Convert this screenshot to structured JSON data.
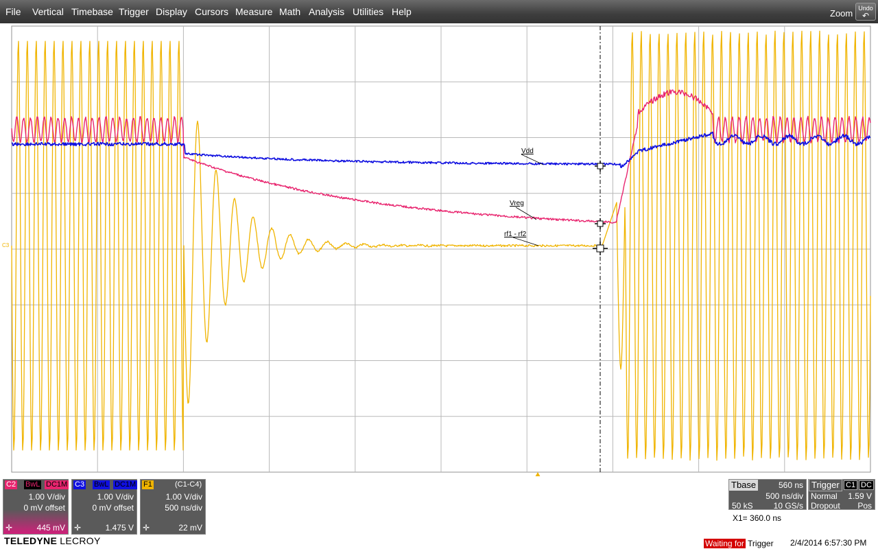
{
  "menu": {
    "items": [
      "File",
      "Vertical",
      "Timebase",
      "Trigger",
      "Display",
      "Cursors",
      "Measure",
      "Math",
      "Analysis",
      "Utilities",
      "Help"
    ],
    "zoom_label": "Zoom",
    "undo_label": "Undo"
  },
  "colors": {
    "c2": "#e8246e",
    "c3": "#1010e0",
    "f1": "#f0b400",
    "grid": "#b8b8b8",
    "cursor": "#000000"
  },
  "chart_data": {
    "type": "line",
    "x_divisions": 10,
    "y_divisions": 8,
    "series": [
      {
        "name": "Vdd",
        "label": "Vdd"
      },
      {
        "name": "Vreg",
        "label": "Vreg"
      },
      {
        "name": "rf1 - rf2",
        "label": "rf1 - rf2"
      }
    ],
    "left_marker": "C3"
  },
  "channels": [
    {
      "id": "C2",
      "badges": [
        "BwL",
        "DC1M"
      ],
      "scale": "1.00 V/div",
      "offset": "0 mV offset",
      "value": "445 mV",
      "cross": "✛"
    },
    {
      "id": "C3",
      "badges": [
        "BwL",
        "DC1M"
      ],
      "scale": "1.00 V/div",
      "offset": "0 mV offset",
      "value": "1.475 V",
      "cross": "✛"
    },
    {
      "id": "F1",
      "badges": [
        "(C1-C4)"
      ],
      "scale": "1.00 V/div",
      "offset": "500 ns/div",
      "value": "22 mV",
      "cross": "✛"
    }
  ],
  "timebase": {
    "title": "Tbase",
    "delay": "560 ns",
    "tdiv": "500 ns/div",
    "samples": "50 kS",
    "rate": "10 GS/s"
  },
  "trigger": {
    "title": "Trigger",
    "badges": [
      "C1",
      "DC"
    ],
    "mode": "Normal",
    "level": "1.59 V",
    "type": "Dropout",
    "slope": "Pos"
  },
  "cursor_readout": "X1=  360.0 ns",
  "status": {
    "waiting": "Waiting for",
    "trigger": " Trigger"
  },
  "datetime": "2/4/2014 6:57:30 PM",
  "logo": {
    "bold": "TELEDYNE",
    "thin": " LECROY"
  }
}
